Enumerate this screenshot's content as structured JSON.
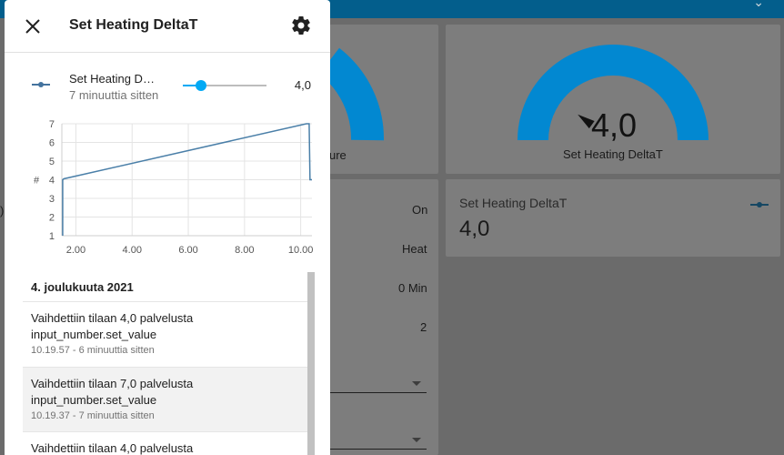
{
  "dialog": {
    "title": "Set Heating DeltaT",
    "close_icon": "close-icon",
    "settings_icon": "gear-icon"
  },
  "entity": {
    "icon": "slider-icon",
    "name": "Set Heating DeltaT",
    "last_changed": "7 minuuttia sitten",
    "slider_fraction": 0.22,
    "value": "4,0",
    "accent_color": "#03a9f4"
  },
  "chart_data": {
    "type": "line",
    "ylabel": "#",
    "ylim": [
      1,
      7
    ],
    "y_ticks": [
      "1",
      "2",
      "3",
      "4",
      "5",
      "6",
      "7"
    ],
    "xlim": [
      1.5,
      10.4
    ],
    "x_ticks": [
      "2.00",
      "4.00",
      "6.00",
      "8.00",
      "10.00"
    ],
    "x_tick_values": [
      2,
      4,
      6,
      8,
      10
    ],
    "series": [
      {
        "color": "#4a7fa8",
        "x": [
          1.53,
          1.53,
          1.57,
          10.2,
          10.3,
          10.33,
          10.4
        ],
        "y": [
          1,
          4.0,
          4.05,
          7.0,
          7.0,
          4.0,
          4.0
        ]
      }
    ],
    "grid": true
  },
  "logbook": {
    "date": "4. joulukuuta 2021",
    "entries": [
      {
        "message": "Vaihdettiin tilaan 4,0 palvelusta input_number.set_value",
        "time": "10.19.57 - 6 minuuttia sitten"
      },
      {
        "message": "Vaihdettiin tilaan 7,0 palvelusta input_number.set_value",
        "time": "10.19.37 - 7 minuuttia sitten"
      },
      {
        "message": "Vaihdettiin tilaan 4,0 palvelusta",
        "time": ""
      }
    ]
  },
  "background": {
    "header_chevron": "chevron-down-icon",
    "gauge_left_label": "ure",
    "gauge_right_value": "4,0",
    "gauge_right_name": "Set Heating DeltaT",
    "gauge_right_fraction": 0.2,
    "gauge_color": "#0288d1",
    "status_rows": [
      "On",
      "Heat",
      "0 Min",
      "2"
    ],
    "edge_text": ")",
    "entity_card_name": "Set Heating DeltaT",
    "entity_card_value": "4,0"
  }
}
